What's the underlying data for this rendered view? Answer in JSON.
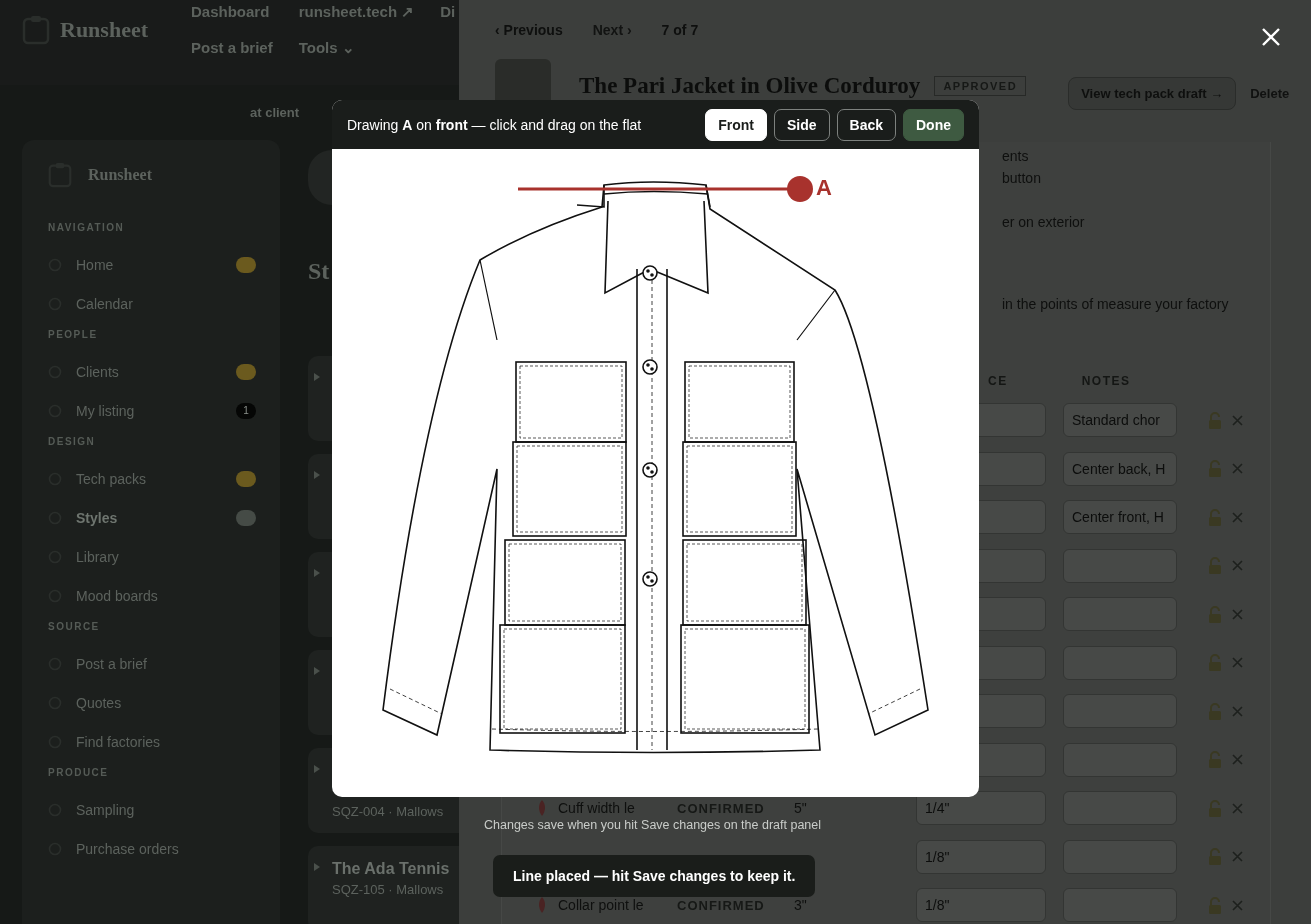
{
  "topnav": {
    "logo": "Runsheet",
    "links": [
      {
        "label": "Dashboard"
      },
      {
        "label": "runsheet.tech ↗"
      },
      {
        "label": "Di"
      },
      {
        "label": "Post a brief"
      },
      {
        "label": "Tools ⌄"
      }
    ]
  },
  "filter_chip": {
    "label": "at client"
  },
  "sidebar": {
    "logo": "Runsheet",
    "sections": [
      {
        "title": "NAVIGATION",
        "items": [
          {
            "label": "Home",
            "selected": false,
            "color": "#6b5a1e"
          },
          {
            "label": "Calendar",
            "selected": false
          }
        ]
      },
      {
        "title": "PEOPLE",
        "items": [
          {
            "label": "Clients",
            "selected": false,
            "color": "#6b5a1e"
          },
          {
            "label": "My listing",
            "selected": false,
            "color": "#050605",
            "badge": "1"
          }
        ]
      },
      {
        "title": "DESIGN",
        "items": [
          {
            "label": "Tech packs",
            "selected": false,
            "color": "#6b5a1e"
          },
          {
            "label": "Styles",
            "selected": true,
            "color": "#454b46"
          },
          {
            "label": "Library",
            "selected": false
          },
          {
            "label": "Mood boards",
            "selected": false
          }
        ]
      },
      {
        "title": "SOURCE",
        "items": [
          {
            "label": "Post a brief",
            "selected": false
          },
          {
            "label": "Quotes",
            "selected": false
          },
          {
            "label": "Find factories",
            "selected": false
          }
        ]
      },
      {
        "title": "PRODUCE",
        "items": [
          {
            "label": "Sampling",
            "selected": false
          },
          {
            "label": "Purchase orders",
            "selected": false
          }
        ]
      }
    ]
  },
  "styles": {
    "heading": "St",
    "cards": [
      {
        "expanded": false
      },
      {
        "expanded": false
      },
      {
        "expanded": false
      },
      {
        "expanded": false
      },
      {
        "expanded": false,
        "meta": "SQZ-004 · Mallows"
      },
      {
        "expanded": false,
        "title": "The Ada Tennis",
        "meta": "SQZ-105 · Mallows"
      }
    ]
  },
  "drawer": {
    "previous": "‹ Previous",
    "next": "Next ›",
    "position": "7 of 7",
    "title": "The Pari Jacket in Olive Corduroy",
    "status": "APPROVED",
    "view_button": "View tech pack draft →",
    "delete_button": "Delete",
    "fragments": [
      "ents",
      "button",
      "er on exterior",
      "in the points of measure your factory"
    ],
    "columns": [
      "CE",
      "NOTES"
    ],
    "rows": [
      {
        "notes": "Standard chor"
      },
      {
        "notes": "Center back, H"
      },
      {
        "notes": "Center front, H"
      },
      {},
      {},
      {},
      {},
      {},
      {
        "name": "Cuff width le",
        "status": "CONFIRMED",
        "value": "5\"",
        "tolerance": "1/4\""
      },
      {
        "tolerance": "1/8\""
      },
      {
        "name": "Collar point le",
        "status": "CONFIRMED",
        "value": "3\"",
        "tolerance": "1/8\""
      }
    ]
  },
  "modal": {
    "instruction": "Drawing **A** on **front** — click and drag on the flat",
    "views": [
      {
        "label": "Front",
        "selected": true
      },
      {
        "label": "Side",
        "selected": false
      },
      {
        "label": "Back",
        "selected": false
      }
    ],
    "done": "Done",
    "measurement": {
      "label": "A",
      "color": "#a8322d"
    },
    "caption": "Changes save when you hit Save changes on the draft panel"
  },
  "toast": "Line placed — hit Save changes to keep it."
}
